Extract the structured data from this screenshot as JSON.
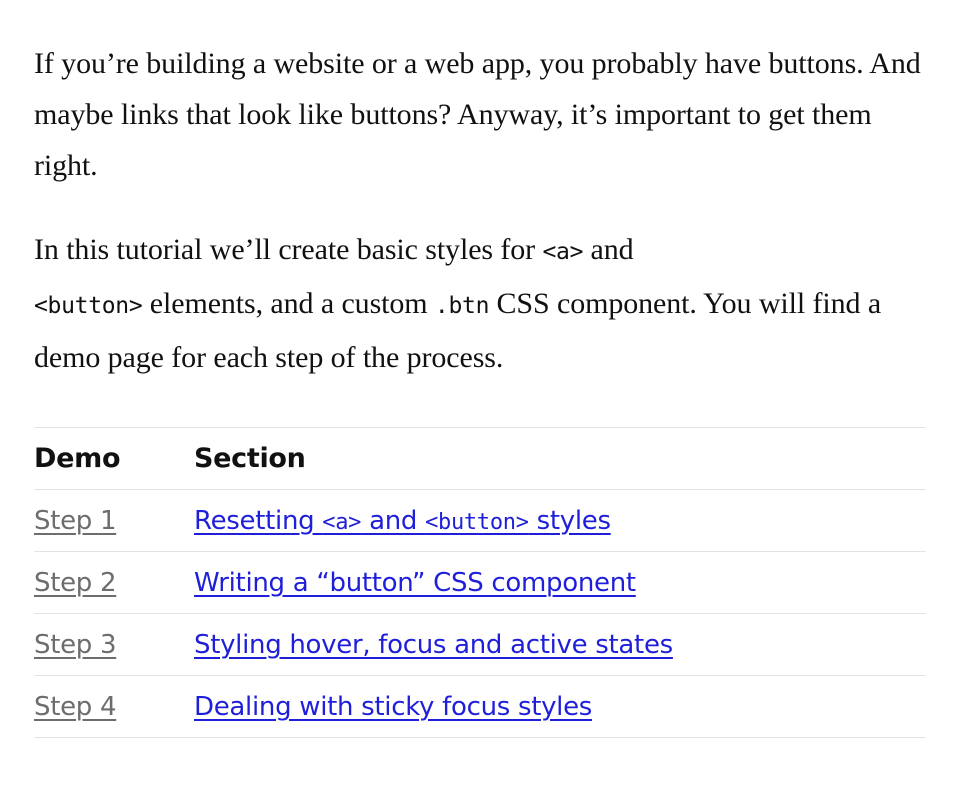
{
  "intro": {
    "p1": "If you’re building a website or a web app, you probably have buttons. And maybe links that look like buttons? Anyway, it’s important to get them right.",
    "p2_part1": "In this tutorial we’ll create basic styles for ",
    "p2_code_a": "<a>",
    "p2_part2": " and ",
    "p2_code_button": "<button>",
    "p2_part3": " elements, and a custom ",
    "p2_code_btn": ".btn",
    "p2_part4": " CSS component. You will find a demo page for each step of the process."
  },
  "table": {
    "headers": {
      "demo": "Demo",
      "section": "Section"
    },
    "rows": [
      {
        "demo": "Step 1",
        "section_part1": "Resetting ",
        "section_code1": "<a>",
        "section_part2": " and ",
        "section_code2": "<button>",
        "section_part3": " styles"
      },
      {
        "demo": "Step 2",
        "section": "Writing a “button” CSS component"
      },
      {
        "demo": "Step 3",
        "section": "Styling hover, focus and active states"
      },
      {
        "demo": "Step 4",
        "section": "Dealing with sticky focus styles"
      }
    ]
  },
  "colors": {
    "link": "#1f1fd9",
    "step_link": "#6d6d6d",
    "text": "#111111",
    "rule": "#e3e3e3"
  }
}
